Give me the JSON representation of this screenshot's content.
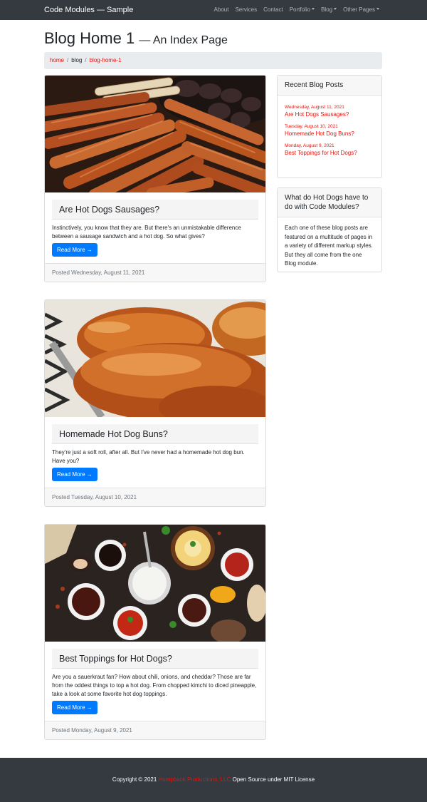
{
  "nav": {
    "brand": "Code Modules — Sample",
    "links": [
      {
        "label": "About"
      },
      {
        "label": "Services"
      },
      {
        "label": "Contact"
      },
      {
        "label": "Portfolio",
        "dropdown": true
      },
      {
        "label": "Blog",
        "dropdown": true
      },
      {
        "label": "Other Pages",
        "dropdown": true
      }
    ]
  },
  "header": {
    "title": "Blog Home 1",
    "subtitle": "— An Index Page"
  },
  "breadcrumb": {
    "home": "home",
    "blog": "blog",
    "current": "blog-home-1"
  },
  "posts": [
    {
      "title": "Are Hot Dogs Sausages?",
      "text": "Instinctively, you know that they are. But there's an unmistakable difference between a sausage sandwich and a hot dog. So what gives?",
      "button": "Read More →",
      "footer": "Posted Wednesday, August 11, 2021",
      "image": "grilled-sausages-photo"
    },
    {
      "title": "Homemade Hot Dog Buns?",
      "text": "They're just a soft roll, after all. But I've never had a homemade hot dog bun. Have you?",
      "button": "Read More →",
      "footer": "Posted Tuesday, August 10, 2021",
      "image": "hot-dog-buns-photo"
    },
    {
      "title": "Best Toppings for Hot Dogs?",
      "text": "Are you a sauerkraut fan? How about chili, onions, and cheddar? Those are far from the oddest things to top a hot dog. From chopped kimchi to diced pineapple, take a look at some favorite hot dog toppings.",
      "button": "Read More →",
      "footer": "Posted Monday, August 9, 2021",
      "image": "sauces-and-toppings-photo"
    }
  ],
  "sidebar": {
    "recent": {
      "heading": "Recent Blog Posts",
      "items": [
        {
          "date": "Wednesday, August 11, 2021",
          "title": "Are Hot Dogs Sausages?"
        },
        {
          "date": "Tuesday, August 10, 2021",
          "title": "Homemade Hot Dog Buns?"
        },
        {
          "date": "Monday, August 9, 2021",
          "title": "Best Toppings for Hot Dogs?"
        }
      ]
    },
    "about": {
      "heading": "What do Hot Dogs have to do with Code Modules?",
      "text": "Each one of these blog posts are featured on a multitude of pages in a variety of different markup styles. But they all come from the one Blog module."
    }
  },
  "footer": {
    "prefix": "Copyright © 2021",
    "company": "Humpback Productions, LLC",
    "suffix": "Open Source under MIT License"
  },
  "colors": {
    "navbar": "#343a40",
    "link": "#e8120b",
    "button": "#007bff"
  }
}
